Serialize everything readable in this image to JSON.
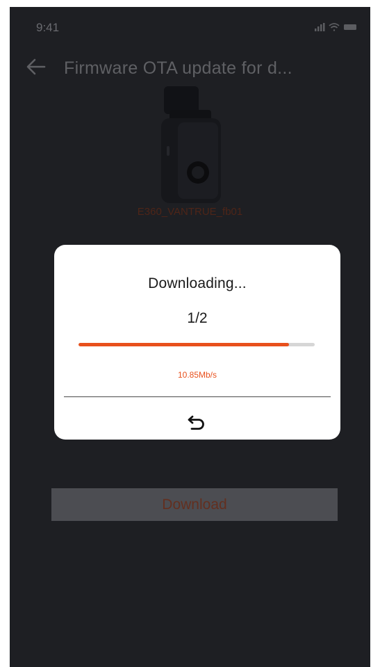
{
  "status_bar": {
    "time": "9:41",
    "icons": [
      "signal-icon",
      "wifi-icon",
      "battery-icon"
    ]
  },
  "header": {
    "back_icon": "back-arrow-icon",
    "title": "Firmware OTA update for d..."
  },
  "device": {
    "image_icon": "dashcam-icon",
    "name": "E360_VANTRUE_fb01"
  },
  "dialog": {
    "title": "Downloading...",
    "step": "1/2",
    "progress_fraction": 0.89,
    "speed": "10.85Mb/s",
    "undo_icon": "undo-icon"
  },
  "download_button": {
    "label": "Download"
  },
  "colors": {
    "background": "#1e1f23",
    "accent": "#e8501c",
    "dialog_bg": "#ffffff",
    "progress_track": "#d6d6d6",
    "disabled_button": "#4c4d52"
  }
}
